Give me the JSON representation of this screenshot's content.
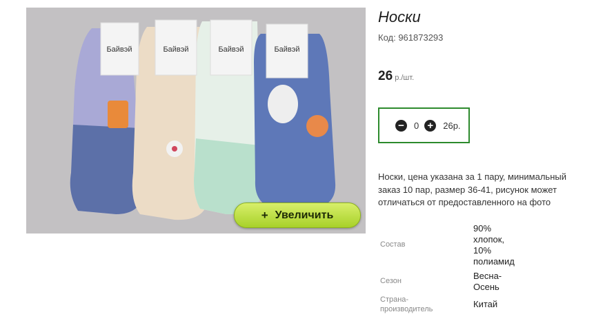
{
  "product": {
    "title": "Носки",
    "code": "Код: 961873293",
    "price": "26",
    "price_unit": " р./шт.",
    "image": {
      "zoom_label": "Увеличить",
      "zoom_icon": "+",
      "brand_tag_text": "Байвэй"
    }
  },
  "quantity": {
    "value": "0",
    "total": "26р.",
    "minus_icon": "minus-circle",
    "plus_icon": "plus-circle",
    "border_color": "#2c8a2c"
  },
  "description": "Носки, цена указана за 1 пару, минимальный заказ 10 пар, размер 36-41, рисунок может отличаться от предоставленного на фото",
  "specs": [
    {
      "label": "Состав",
      "value": "90% хлопок, 10% полиамид"
    },
    {
      "label": "Сезон",
      "value": "Весна-Осень"
    },
    {
      "label": "Страна-производитель",
      "value": "Китай"
    }
  ]
}
